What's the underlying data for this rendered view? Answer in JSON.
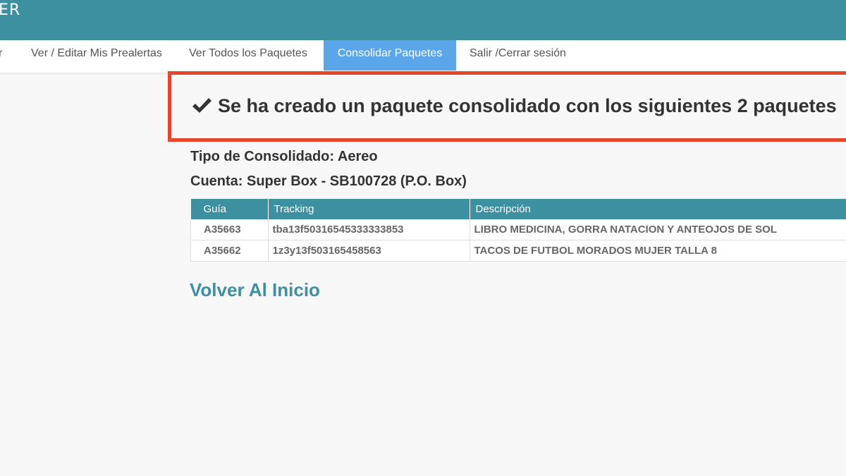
{
  "header": {
    "brand": "ER",
    "brand_sub": "/"
  },
  "nav": {
    "items": [
      {
        "label": "r"
      },
      {
        "label": "Ver / Editar Mis Prealertas"
      },
      {
        "label": "Ver Todos los Paquetes"
      },
      {
        "label": "Consolidar Paquetes",
        "active": true
      },
      {
        "label": "Salir /Cerrar sesión"
      }
    ]
  },
  "alert": {
    "icon": "checkmark-icon",
    "message": "Se ha creado un paquete consolidado con los siguientes 2 paquetes"
  },
  "info": {
    "tipo": "Tipo de Consolidado: Aereo",
    "cuenta": "Cuenta: Super Box - SB100728 (P.O. Box)"
  },
  "table": {
    "headers": [
      "Guía",
      "Tracking",
      "Descripción"
    ],
    "rows": [
      [
        "A35663",
        "tba13f50316545333333853",
        "LIBRO MEDICINA, GORRA NATACION Y ANTEOJOS DE SOL"
      ],
      [
        "A35662",
        "1z3y13f503165458563",
        "TACOS DE FUTBOL MORADOS MUJER TALLA 8"
      ]
    ]
  },
  "back_link": "Volver Al Inicio",
  "colors": {
    "header_bg": "#3d90a0",
    "nav_active_bg": "#5ba6eb",
    "alert_border": "#e8442a",
    "link": "#3d90a0"
  }
}
